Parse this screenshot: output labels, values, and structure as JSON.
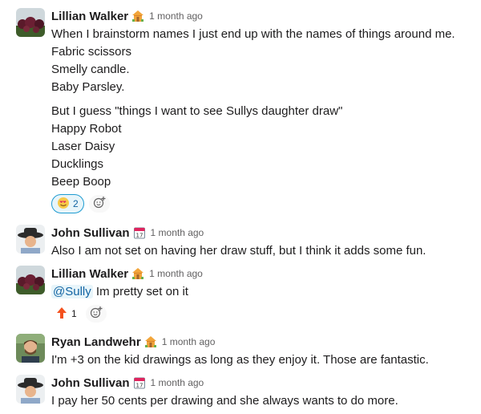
{
  "messages": [
    {
      "name": "Lillian Walker",
      "status_icon": "house-emoji",
      "time": "1 month ago",
      "lines": [
        "When I brainstorm names I just end up with the names of things around me.",
        "Fabric scissors",
        "Smelly candle.",
        "Baby Parsley."
      ],
      "lines2": [
        "But I guess \"things I want to see Sullys daughter draw\"",
        "Happy Robot",
        "Laser Daisy",
        "Ducklings",
        "Beep Boop"
      ],
      "reaction": {
        "icon": "heart-eyes-emoji",
        "count": "2"
      }
    },
    {
      "name": "John Sullivan",
      "status_icon": "calendar-emoji",
      "time": "1 month ago",
      "lines": [
        "Also I am not set on having her draw stuff, but I think it adds some fun."
      ]
    },
    {
      "name": "Lillian Walker",
      "status_icon": "house-emoji",
      "time": "1 month ago",
      "mention": "@Sully",
      "text": " Im pretty set on it",
      "reaction": {
        "icon": "arrow-up-emoji",
        "count": "1"
      }
    },
    {
      "name": "Ryan Landwehr",
      "status_icon": "house-emoji",
      "time": "1 month ago",
      "lines": [
        "I'm +3 on the kid drawings as long as they enjoy it. Those are fantastic."
      ]
    },
    {
      "name": "John Sullivan",
      "status_icon": "calendar-emoji",
      "time": "1 month ago",
      "lines": [
        "I pay her 50 cents per drawing and she always wants to do more."
      ]
    }
  ],
  "colors": {
    "mention": "#1264a3",
    "reaction_border": "#1d9bd1",
    "timestamp": "#616061"
  }
}
